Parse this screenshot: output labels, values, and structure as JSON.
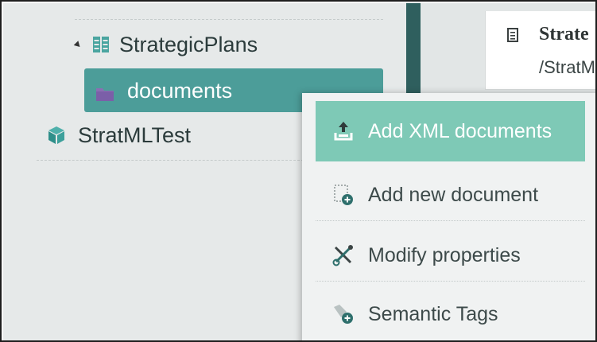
{
  "tree": {
    "items": [
      {
        "label": "StrategicPlans",
        "expanded": true,
        "icon": "bookshelf-icon"
      },
      {
        "label": "documents",
        "expanded": false,
        "selected": true,
        "icon": "folder-icon"
      },
      {
        "label": "StratMLTest",
        "expanded": false,
        "icon": "cube-icon"
      }
    ]
  },
  "detail": {
    "title": "Strate",
    "path": "/StratM",
    "icon": "document-icon"
  },
  "context_menu": {
    "items": [
      {
        "label": "Add XML documents",
        "icon": "upload-tray-icon",
        "active": true
      },
      {
        "label": "Add new document",
        "icon": "new-document-icon"
      },
      {
        "label": "Modify properties",
        "icon": "tools-icon"
      },
      {
        "label": "Semantic Tags",
        "icon": "tag-add-icon"
      }
    ]
  },
  "colors": {
    "selected_row": "#4c9d99",
    "menu_active": "#7ec9b6",
    "divider": "#2f5f5e"
  }
}
